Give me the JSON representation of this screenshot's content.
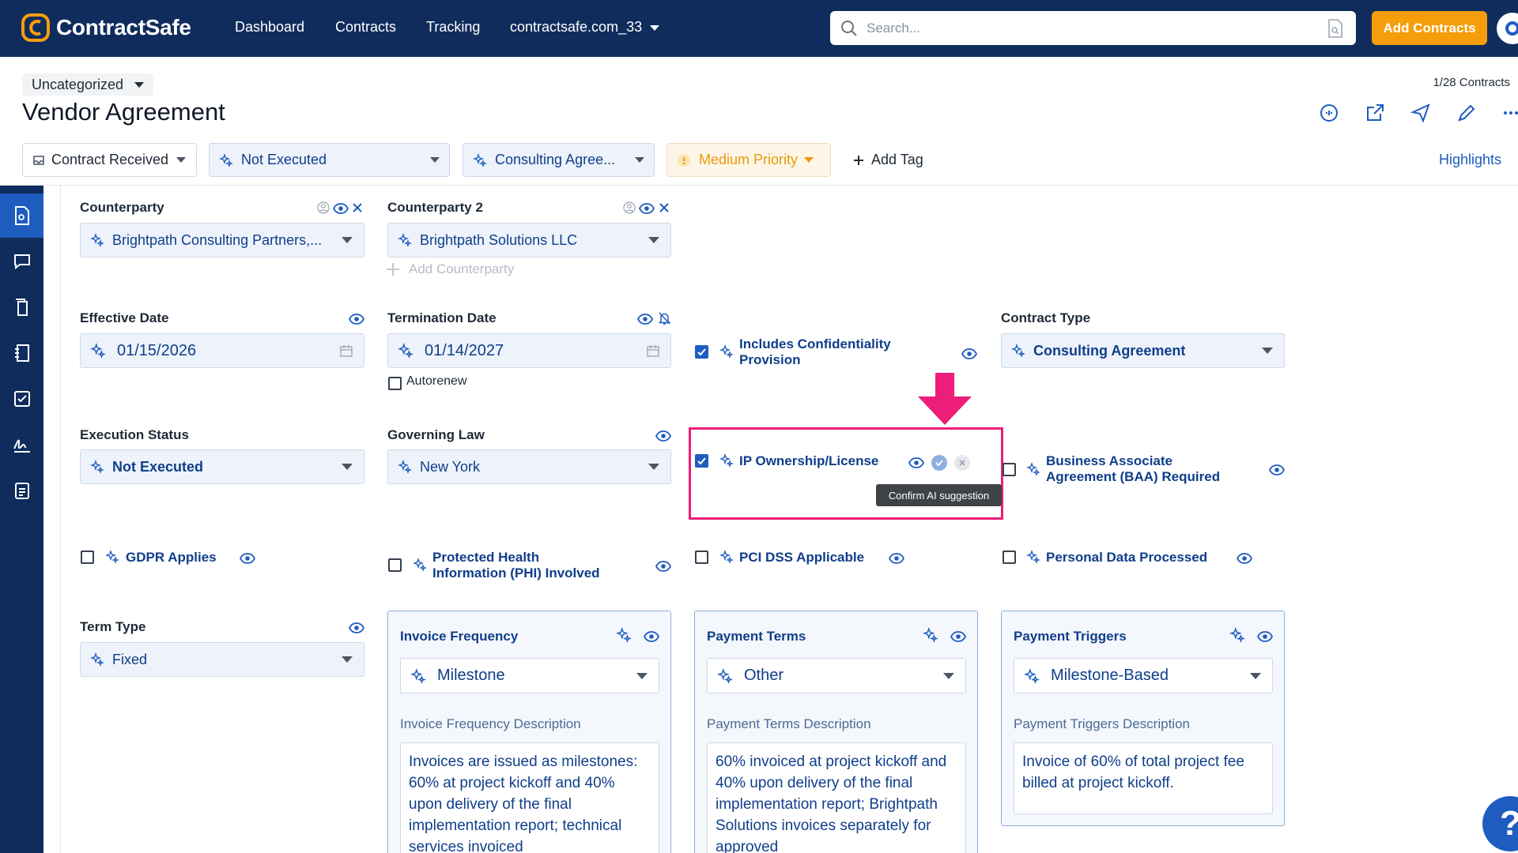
{
  "app": {
    "name": "ContractSafe"
  },
  "nav": {
    "links": [
      "Dashboard",
      "Contracts",
      "Tracking"
    ],
    "account": "contractsafe.com_33",
    "search_placeholder": "Search...",
    "add_contracts": "Add Contracts"
  },
  "header": {
    "category": "Uncategorized",
    "title": "Vendor Agreement",
    "count": "1/28 Contracts"
  },
  "status_row": {
    "stage": "Contract Received",
    "execution": "Not Executed",
    "type": "Consulting Agree...",
    "priority": "Medium Priority",
    "add_tag": "Add Tag",
    "highlights": "Highlights"
  },
  "fields": {
    "counterparty": {
      "label": "Counterparty",
      "value": "Brightpath Consulting Partners,..."
    },
    "counterparty2": {
      "label": "Counterparty 2",
      "value": "Brightpath Solutions LLC"
    },
    "add_counterparty": "Add Counterparty",
    "effective_date": {
      "label": "Effective Date",
      "value": "01/15/2026"
    },
    "termination_date": {
      "label": "Termination Date",
      "value": "01/14/2027"
    },
    "autorenew": "Autorenew",
    "confidentiality": {
      "line1": "Includes Confidentiality",
      "line2": "Provision",
      "checked": true
    },
    "contract_type": {
      "label": "Contract Type",
      "value": "Consulting Agreement"
    },
    "execution_status": {
      "label": "Execution Status",
      "value": "Not Executed"
    },
    "governing_law": {
      "label": "Governing Law",
      "value": "New York"
    },
    "ip_ownership": {
      "label": "IP Ownership/License",
      "checked": true
    },
    "baa": {
      "line1": "Business Associate",
      "line2": "Agreement (BAA) Required",
      "checked": false
    },
    "tooltip": "Confirm AI suggestion",
    "gdpr": {
      "label": "GDPR Applies",
      "checked": false
    },
    "phi": {
      "line1": "Protected Health",
      "line2": "Information (PHI) Involved",
      "checked": false
    },
    "pci": {
      "label": "PCI DSS Applicable",
      "checked": false
    },
    "personal_data": {
      "label": "Personal Data Processed",
      "checked": false
    },
    "term_type": {
      "label": "Term Type",
      "value": "Fixed"
    }
  },
  "cards": [
    {
      "title": "Invoice Frequency",
      "value": "Milestone",
      "desc_label": "Invoice Frequency Description",
      "text": "Invoices are issued as milestones: 60% at project kickoff and 40% upon delivery of the final implementation report; technical services invoiced"
    },
    {
      "title": "Payment Terms",
      "value": "Other",
      "desc_label": "Payment Terms Description",
      "text": "60% invoiced at project kickoff and 40% upon delivery of the final implementation report; Brightpath Solutions invoices separately for approved"
    },
    {
      "title": "Payment Triggers",
      "value": "Milestone-Based",
      "desc_label": "Payment Triggers Description",
      "text": "Invoice of 60% of total project fee billed at project kickoff."
    }
  ],
  "colors": {
    "nav": "#0f2c5c",
    "accent": "#1f5cc0",
    "ai_text": "#0f3e8a",
    "orange": "#f59e0b",
    "highlight": "#ec1e79"
  }
}
